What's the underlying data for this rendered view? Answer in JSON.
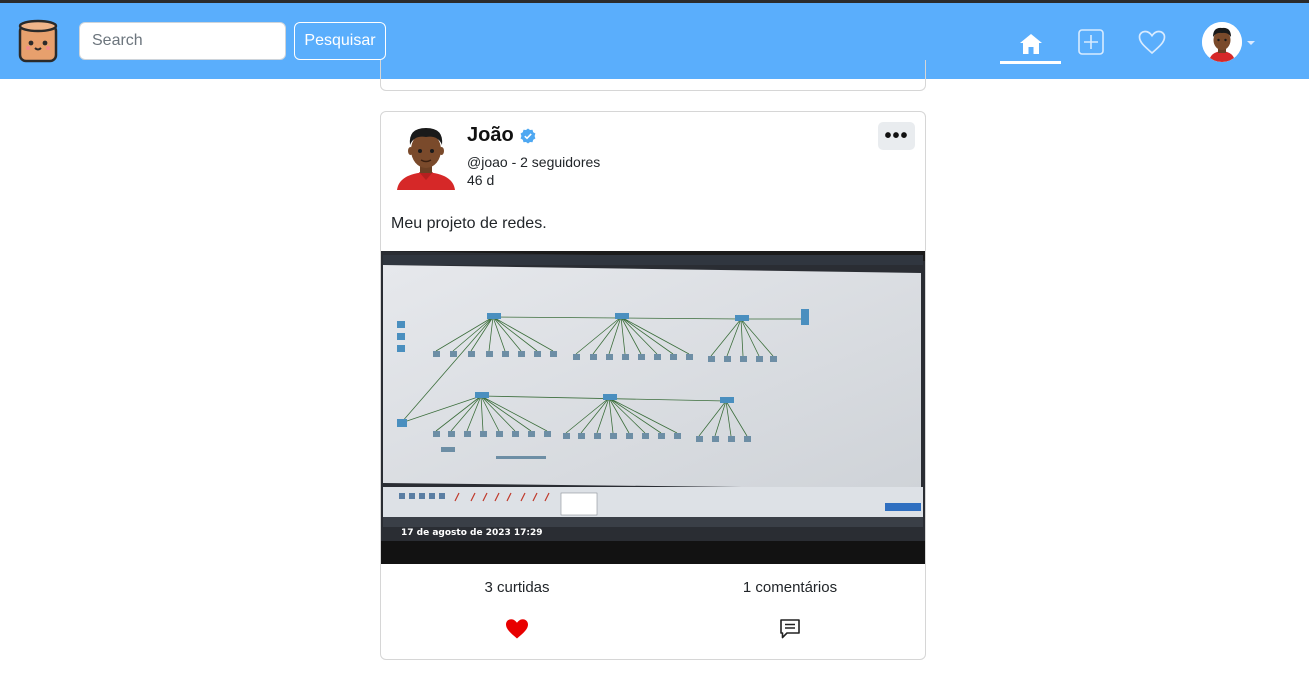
{
  "app": {
    "logo_icon": "barrel-face-logo-icon",
    "accent_color": "#5aaefc"
  },
  "search": {
    "placeholder": "Search",
    "button_label": "Pesquisar"
  },
  "nav": {
    "home_icon": "home-icon",
    "add_icon": "plus-square-icon",
    "likes_icon": "heart-outline-icon",
    "profile_icon": "avatar-icon"
  },
  "post": {
    "author_name": "João",
    "verified": true,
    "author_meta": "@joao - 2 seguidores",
    "age": "46 d",
    "more_label": "•••",
    "text": "Meu projeto de redes.",
    "image_timestamp": "17 de agosto de 2023 17:29",
    "likes_label": "3 curtidas",
    "comments_label": "1 comentários",
    "liked": true,
    "like_color": "#e80000"
  }
}
